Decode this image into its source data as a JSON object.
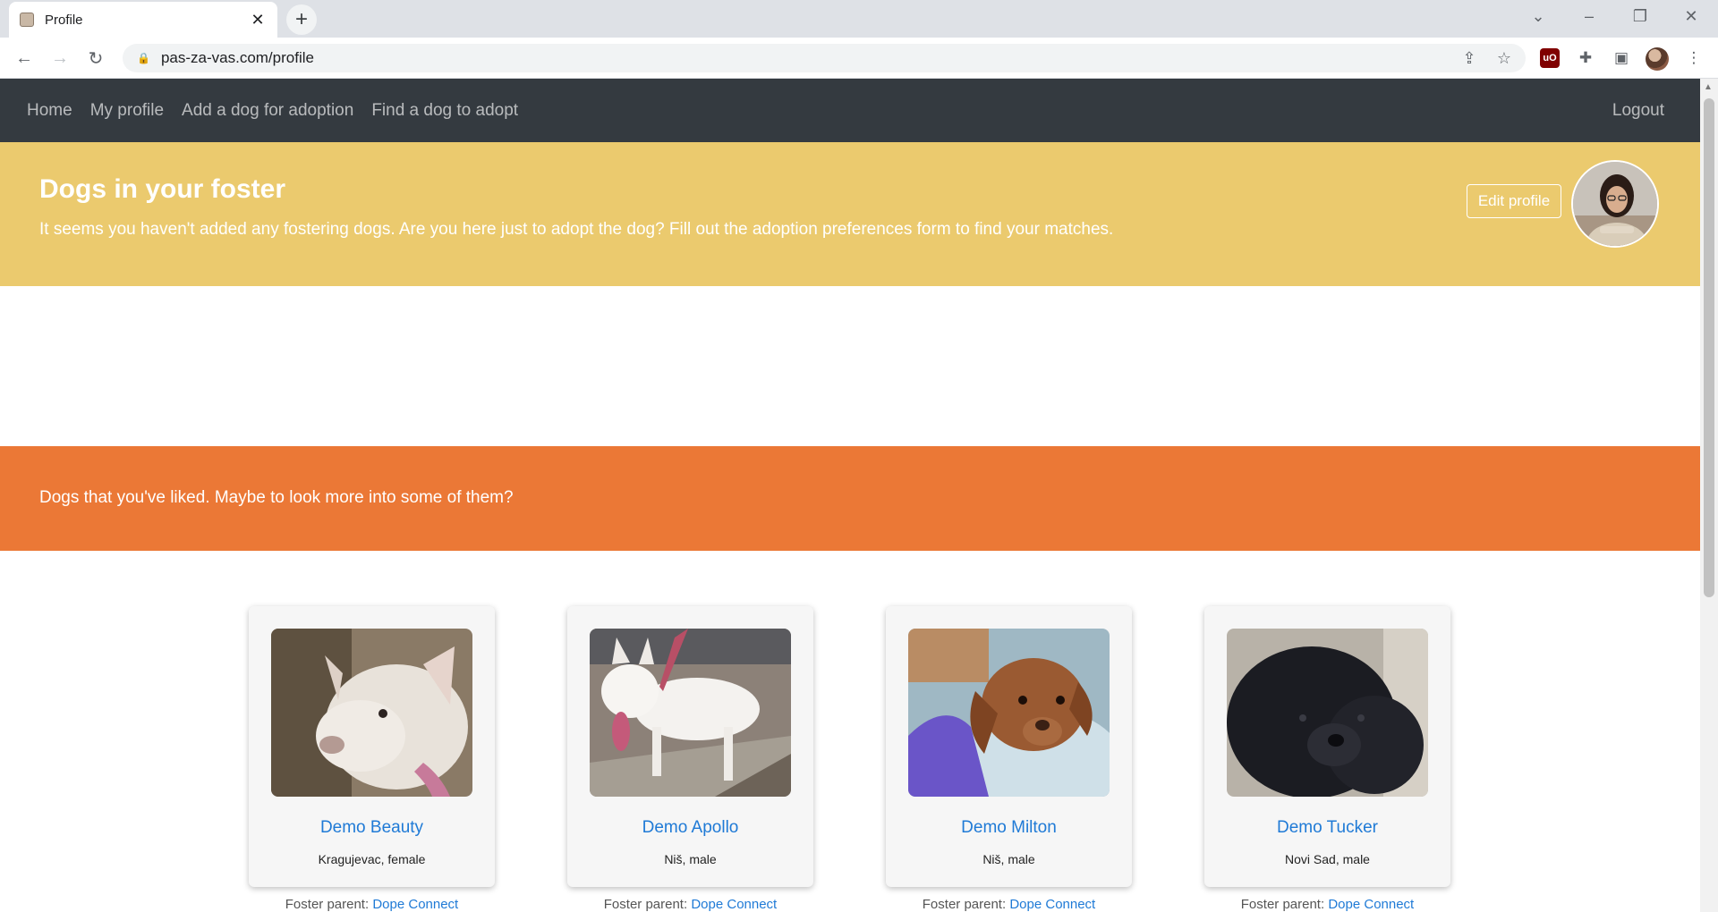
{
  "browser": {
    "tab_title": "Profile",
    "url": "pas-za-vas.com/profile"
  },
  "navbar": {
    "links": [
      "Home",
      "My profile",
      "Add a dog for adoption",
      "Find a dog to adopt"
    ],
    "logout": "Logout"
  },
  "foster": {
    "title": "Dogs in your foster",
    "message": "It seems you haven't added any fostering dogs. Are you here just to adopt the dog? Fill out the adoption preferences form to find your matches.",
    "edit_button": "Edit profile"
  },
  "liked": {
    "message": "Dogs that you've liked. Maybe to look more into some of them?"
  },
  "dogs": [
    {
      "name": "Demo Beauty",
      "location": "Kragujevac, female",
      "foster_label": "Foster parent:",
      "foster_parent": "Dope Connect"
    },
    {
      "name": "Demo Apollo",
      "location": "Niš, male",
      "foster_label": "Foster parent:",
      "foster_parent": "Dope Connect"
    },
    {
      "name": "Demo Milton",
      "location": "Niš, male",
      "foster_label": "Foster parent:",
      "foster_parent": "Dope Connect"
    },
    {
      "name": "Demo Tucker",
      "location": "Novi Sad, male",
      "foster_label": "Foster parent:",
      "foster_parent": "Dope Connect"
    }
  ],
  "colors": {
    "navbar": "#343a40",
    "foster_band": "#ebca6e",
    "liked_band": "#eb7836",
    "link": "#1f7ad6"
  },
  "icons": [
    "back-arrow-icon",
    "forward-arrow-icon",
    "reload-icon",
    "lock-icon",
    "share-icon",
    "star-icon",
    "ublock-icon",
    "puzzle-icon",
    "sidepanel-icon",
    "kebab-menu-icon"
  ]
}
